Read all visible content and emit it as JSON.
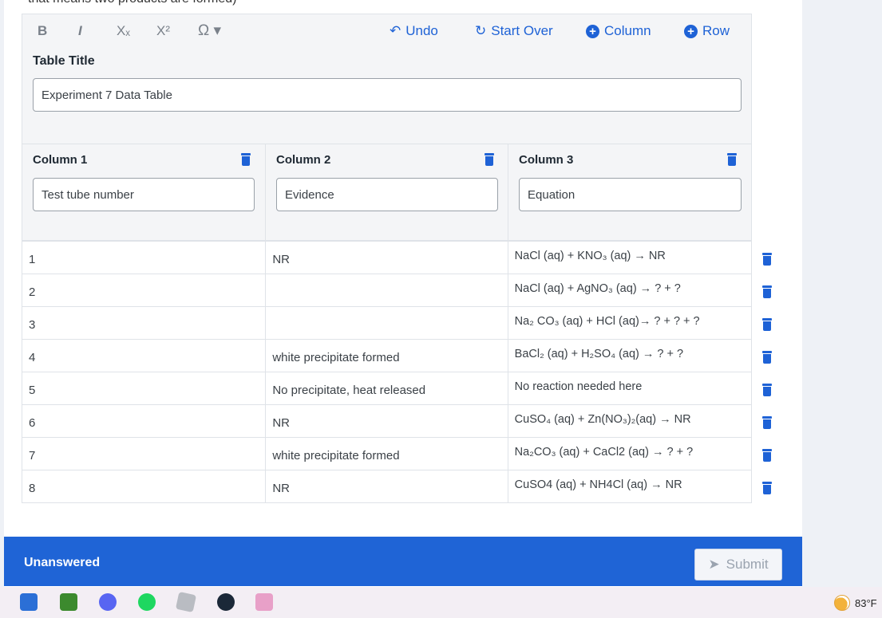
{
  "question_text": "that means two products are formed)",
  "toolbar": {
    "bold": "B",
    "italic": "I",
    "subscript": "Xₓ",
    "superscript": "X²",
    "symbol": "Ω ▾",
    "undo": "Undo",
    "start_over": "Start Over",
    "add_column": "Column",
    "add_row": "Row"
  },
  "table_title": {
    "label": "Table Title",
    "value": "Experiment 7 Data Table"
  },
  "columns": [
    {
      "label": "Column 1",
      "value": "Test tube number"
    },
    {
      "label": "Column 2",
      "value": "Evidence"
    },
    {
      "label": "Column 3",
      "value": "Equation"
    }
  ],
  "rows": [
    {
      "c1": "1",
      "c2": "NR",
      "c3": "NaCl (aq) + KNO₃ (aq) → NR"
    },
    {
      "c1": "2",
      "c2": "",
      "c3": "NaCl (aq) + AgNO₃ (aq) → ? + ?"
    },
    {
      "c1": "3",
      "c2": "",
      "c3": "Na₂ CO₃ (aq) + HCl (aq)→ ? + ? + ?"
    },
    {
      "c1": "4",
      "c2": "white precipitate formed",
      "c3": "BaCl₂ (aq) + H₂SO₄ (aq) → ? + ?"
    },
    {
      "c1": "5",
      "c2": "No precipitate, heat released",
      "c3": "No reaction needed here"
    },
    {
      "c1": "6",
      "c2": "NR",
      "c3": "CuSO₄ (aq) + Zn(NO₃)₂(aq) → NR"
    },
    {
      "c1": "7",
      "c2": "white precipitate formed",
      "c3": "Na₂CO₃ (aq) + CaCl2 (aq)  → ? + ?"
    },
    {
      "c1": "8",
      "c2": "NR",
      "c3": "CuSO4 (aq) + NH4Cl (aq) → NR"
    }
  ],
  "footer": {
    "status": "Unanswered",
    "submit": "Submit"
  },
  "taskbar": {
    "temperature": "83°F",
    "icons": [
      "store-icon",
      "minecraft-icon",
      "discord-icon",
      "spotify-icon",
      "roblox-icon",
      "steam-icon",
      "game-icon"
    ]
  },
  "colors": {
    "accent": "#1e62d6",
    "footer_bg": "#1f64d6"
  }
}
